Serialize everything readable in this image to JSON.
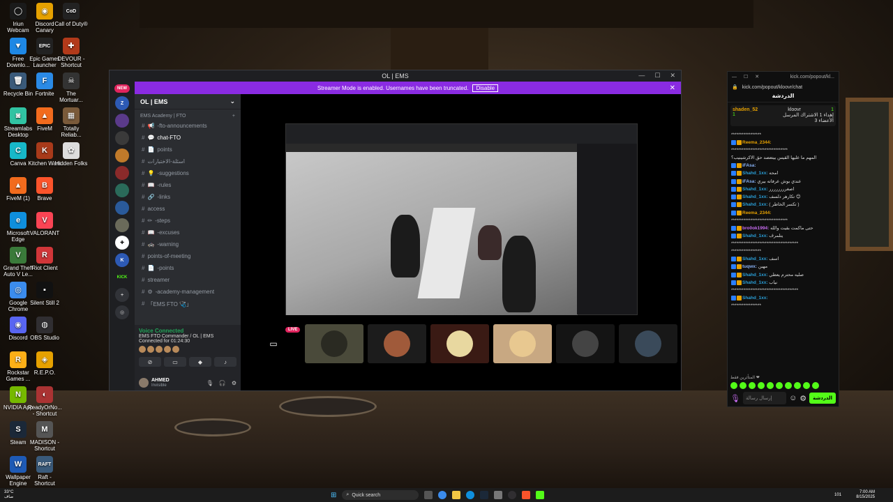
{
  "desktop_icons": [
    {
      "label": "Iriun Webcam",
      "glyph": "◯",
      "color": "#1a1a1a"
    },
    {
      "label": "Discord Canary",
      "glyph": "◉",
      "color": "#e6a100"
    },
    {
      "label": "Call of Duty®",
      "glyph": "CoD",
      "color": "#222"
    },
    {
      "label": "Free Downlo...",
      "glyph": "▼",
      "color": "#1e88e5"
    },
    {
      "label": "Epic Games Launcher",
      "glyph": "EPIC",
      "color": "#222"
    },
    {
      "label": "DEVOUR - Shortcut",
      "glyph": "✚",
      "color": "#b23a1a"
    },
    {
      "label": "Recycle Bin",
      "glyph": "🗑",
      "color": "#3a5a7a"
    },
    {
      "label": "Fortnite",
      "glyph": "F",
      "color": "#2a8ae6"
    },
    {
      "label": "The Mortuar...",
      "glyph": "☠",
      "color": "#333"
    },
    {
      "label": "Streamlabs Desktop",
      "glyph": "◙",
      "color": "#31c3a2"
    },
    {
      "label": "FiveM",
      "glyph": "▲",
      "color": "#f26b1d"
    },
    {
      "label": "Totally Reliab...",
      "glyph": "▦",
      "color": "#7a5a3a"
    },
    {
      "label": "Canva",
      "glyph": "C",
      "color": "#17b8c8"
    },
    {
      "label": "Kitchen Wars",
      "glyph": "K",
      "color": "#a83a1a"
    },
    {
      "label": "Hidden Folks",
      "glyph": "✿",
      "color": "#ddd"
    },
    {
      "label": "FiveM (1)",
      "glyph": "▲",
      "color": "#f26b1d"
    },
    {
      "label": "Brave",
      "glyph": "B",
      "color": "#fb542b"
    },
    {
      "label": "Microsoft Edge",
      "glyph": "e",
      "color": "#0f8fdd"
    },
    {
      "label": "VALORANT",
      "glyph": "V",
      "color": "#fa4454"
    },
    {
      "label": "Grand Theft Auto V Le...",
      "glyph": "V",
      "color": "#3a7a3a"
    },
    {
      "label": "Riot Client",
      "glyph": "R",
      "color": "#d13639"
    },
    {
      "label": "Google Chrome",
      "glyph": "◎",
      "color": "#3b8ced"
    },
    {
      "label": "Silent Still 2",
      "glyph": "▪",
      "color": "#111"
    },
    {
      "label": "Discord",
      "glyph": "◉",
      "color": "#5865f2"
    },
    {
      "label": "OBS Studio",
      "glyph": "◍",
      "color": "#302e31"
    },
    {
      "label": "Rockstar Games ...",
      "glyph": "R",
      "color": "#fcaf17"
    },
    {
      "label": "R.E.P.O.",
      "glyph": "◈",
      "color": "#e6a100"
    },
    {
      "label": "NVIDIA App",
      "glyph": "N",
      "color": "#76b900"
    },
    {
      "label": "ReadyOrNo... - Shortcut",
      "glyph": "◐",
      "color": "#aa3333"
    },
    {
      "label": "Steam",
      "glyph": "S",
      "color": "#1b2838"
    },
    {
      "label": "MADISON - Shortcut",
      "glyph": "M",
      "color": "#555"
    },
    {
      "label": "Wallpaper Engine",
      "glyph": "W",
      "color": "#1e5ab5"
    },
    {
      "label": "Raft - Shortcut",
      "glyph": "RAFT",
      "color": "#3a5a7a"
    }
  ],
  "discord": {
    "title": "OL | EMS",
    "banner_text": "Streamer Mode is enabled. Usernames have been truncated.",
    "banner_button": "Disable",
    "server_name": "OL | EMS",
    "new_badge": "NEW",
    "kick_label": "KICK",
    "category": "EMS Academy | FTO",
    "channels": [
      {
        "name": "-fto-announcements",
        "icon": "📢",
        "active": false
      },
      {
        "name": "chat-FTO",
        "icon": "💬",
        "active": true
      },
      {
        "name": "points",
        "icon": "📄",
        "active": false
      },
      {
        "name": "اسئلة-الاختبارات",
        "icon": "",
        "active": false
      },
      {
        "name": "-suggestions",
        "icon": "💡",
        "active": false
      },
      {
        "name": "-rules",
        "icon": "📖",
        "active": false
      },
      {
        "name": "-links",
        "icon": "🔗",
        "active": false
      },
      {
        "name": "access",
        "icon": "",
        "active": false
      },
      {
        "name": "-steps",
        "icon": "✏",
        "active": false
      },
      {
        "name": "-excuses",
        "icon": "📖",
        "active": false
      },
      {
        "name": "-warning",
        "icon": "🚓",
        "active": false
      },
      {
        "name": "points-of-meeting",
        "icon": "",
        "active": false
      },
      {
        "name": "-points",
        "icon": "📄",
        "active": false
      },
      {
        "name": "streamer",
        "icon": "",
        "active": false
      },
      {
        "name": "-academy-management",
        "icon": "⚙",
        "active": false
      },
      {
        "name": "「EMS FTO 🩺」",
        "icon": "",
        "active": false
      }
    ],
    "voice": {
      "status": "Voice Connected",
      "channel": "EMS FTO Commander / OL | EMS",
      "connected_for": "Connected for 01:24:30"
    },
    "user": {
      "name": "AHMED",
      "status": "Invisible"
    },
    "live_badge": "LIVE"
  },
  "kick": {
    "url": "kick.com/popout/kloovr/chat",
    "url_short": "kick.com/popout/kl...",
    "header": "الدردشة",
    "pinned_user": "shaden_52",
    "pinned_streamer": "kloovr",
    "pinned_text": "إهداء 1 الاشتراك المرسل",
    "pinned_sub": "الأعضاء 3",
    "count_1": "1",
    "count_2": "1",
    "messages": [
      {
        "user": "",
        "text": "*****************",
        "color": "#aaa"
      },
      {
        "user": "Reema_2344:",
        "text": "",
        "color": "#e6a100"
      },
      {
        "user": "",
        "text": "********************************",
        "color": "#aaa"
      },
      {
        "user": "",
        "text": "المهم ما عليها القيس بيتعضد حق الاكرشينيب؟",
        "color": "#aaa"
      },
      {
        "user": "iFAsa:",
        "text": "",
        "color": "#8ab4f8"
      },
      {
        "user": "Shahd_1xx:",
        "text": "امحه",
        "color": "#2a9fd8"
      },
      {
        "user": "iFAsa:",
        "text": "عندي بوش عرفاته بيري",
        "color": "#8ab4f8"
      },
      {
        "user": "Shahd_1xx:",
        "text": "اصغرررررررر",
        "color": "#2a9fd8"
      },
      {
        "user": "Shahd_1xx:",
        "text": "تكارهر دلسف 😊",
        "color": "#2a9fd8"
      },
      {
        "user": "Shahd_1xx:",
        "text": "( تكسر الخاطر )",
        "color": "#2a9fd8"
      },
      {
        "user": "Reema_2344:",
        "text": "",
        "color": "#e6a100"
      },
      {
        "user": "",
        "text": "********************************",
        "color": "#aaa"
      },
      {
        "user": "bro0ok1994:",
        "text": "حتى ماكمت بقيت والله",
        "color": "#c76cf0"
      },
      {
        "user": "Shahd_1xx:",
        "text": "يتلمرف",
        "color": "#2a9fd8"
      },
      {
        "user": "",
        "text": "**************************************",
        "color": "#aaa"
      },
      {
        "user": "",
        "text": "*****************",
        "color": "#aaa"
      },
      {
        "user": "Shahd_1xx:",
        "text": "اسف",
        "color": "#2a9fd8"
      },
      {
        "user": "tuqwx:",
        "text": "مهبن",
        "color": "#8ab4f8"
      },
      {
        "user": "Shahd_1xx:",
        "text": "صليه محترم يعطي",
        "color": "#2a9fd8"
      },
      {
        "user": "Shahd_1xx:",
        "text": "نياب",
        "color": "#2a9fd8"
      },
      {
        "user": "",
        "text": "**************************************",
        "color": "#aaa"
      },
      {
        "user": "Shahd_1xx:",
        "text": "",
        "color": "#2a9fd8"
      },
      {
        "user": "",
        "text": "*****************",
        "color": "#aaa"
      }
    ],
    "sort_label": "المتأثرين فقط ❤",
    "input_placeholder": "إرسال رسالة",
    "send_label": "الدردشة"
  },
  "taskbar": {
    "weather_temp": "33°C",
    "weather_desc": "صاف",
    "search_placeholder": "Quick search",
    "time": "7:00 AM",
    "date": "8/15/2025",
    "tray_label": "101"
  }
}
